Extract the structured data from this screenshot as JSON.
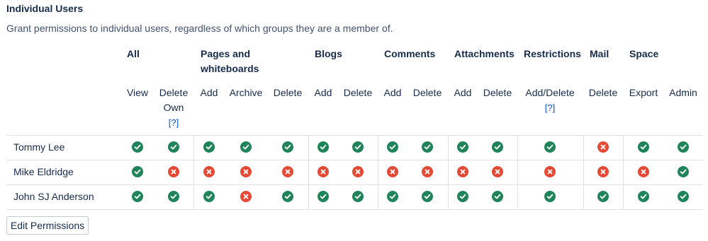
{
  "section": {
    "title": "Individual Users",
    "description": "Grant permissions to individual users, regardless of which groups they are a member of."
  },
  "groups": [
    {
      "label": "All"
    },
    {
      "label": "Pages and",
      "label2": "whiteboards"
    },
    {
      "label": "Blogs"
    },
    {
      "label": "Comments"
    },
    {
      "label": "Attachments"
    },
    {
      "label": "Restrictions"
    },
    {
      "label": "Mail"
    },
    {
      "label": "Space"
    }
  ],
  "columns": [
    {
      "label": "View"
    },
    {
      "label": "Delete",
      "label2": "Own",
      "help": "[?]"
    },
    {
      "label": "Add"
    },
    {
      "label": "Archive"
    },
    {
      "label": "Delete"
    },
    {
      "label": "Add"
    },
    {
      "label": "Delete"
    },
    {
      "label": "Add"
    },
    {
      "label": "Delete"
    },
    {
      "label": "Add"
    },
    {
      "label": "Delete"
    },
    {
      "label": "Add/Delete",
      "help": "[?]"
    },
    {
      "label": "Delete"
    },
    {
      "label": "Export"
    },
    {
      "label": "Admin"
    }
  ],
  "users": [
    {
      "name": "Tommy Lee",
      "perms": [
        true,
        true,
        true,
        true,
        true,
        true,
        true,
        true,
        true,
        true,
        true,
        true,
        false,
        true,
        true
      ]
    },
    {
      "name": "Mike Eldridge",
      "perms": [
        true,
        false,
        false,
        false,
        false,
        false,
        false,
        false,
        false,
        false,
        false,
        false,
        false,
        false,
        true
      ]
    },
    {
      "name": "John SJ Anderson",
      "perms": [
        true,
        true,
        true,
        false,
        true,
        true,
        true,
        true,
        true,
        true,
        true,
        true,
        true,
        true,
        true
      ]
    }
  ],
  "colors": {
    "granted": "#1f845a",
    "denied": "#e34935"
  },
  "icons": {
    "granted": "check-circle-icon",
    "denied": "cross-circle-icon"
  },
  "edit_button": {
    "label": "Edit Permissions"
  }
}
